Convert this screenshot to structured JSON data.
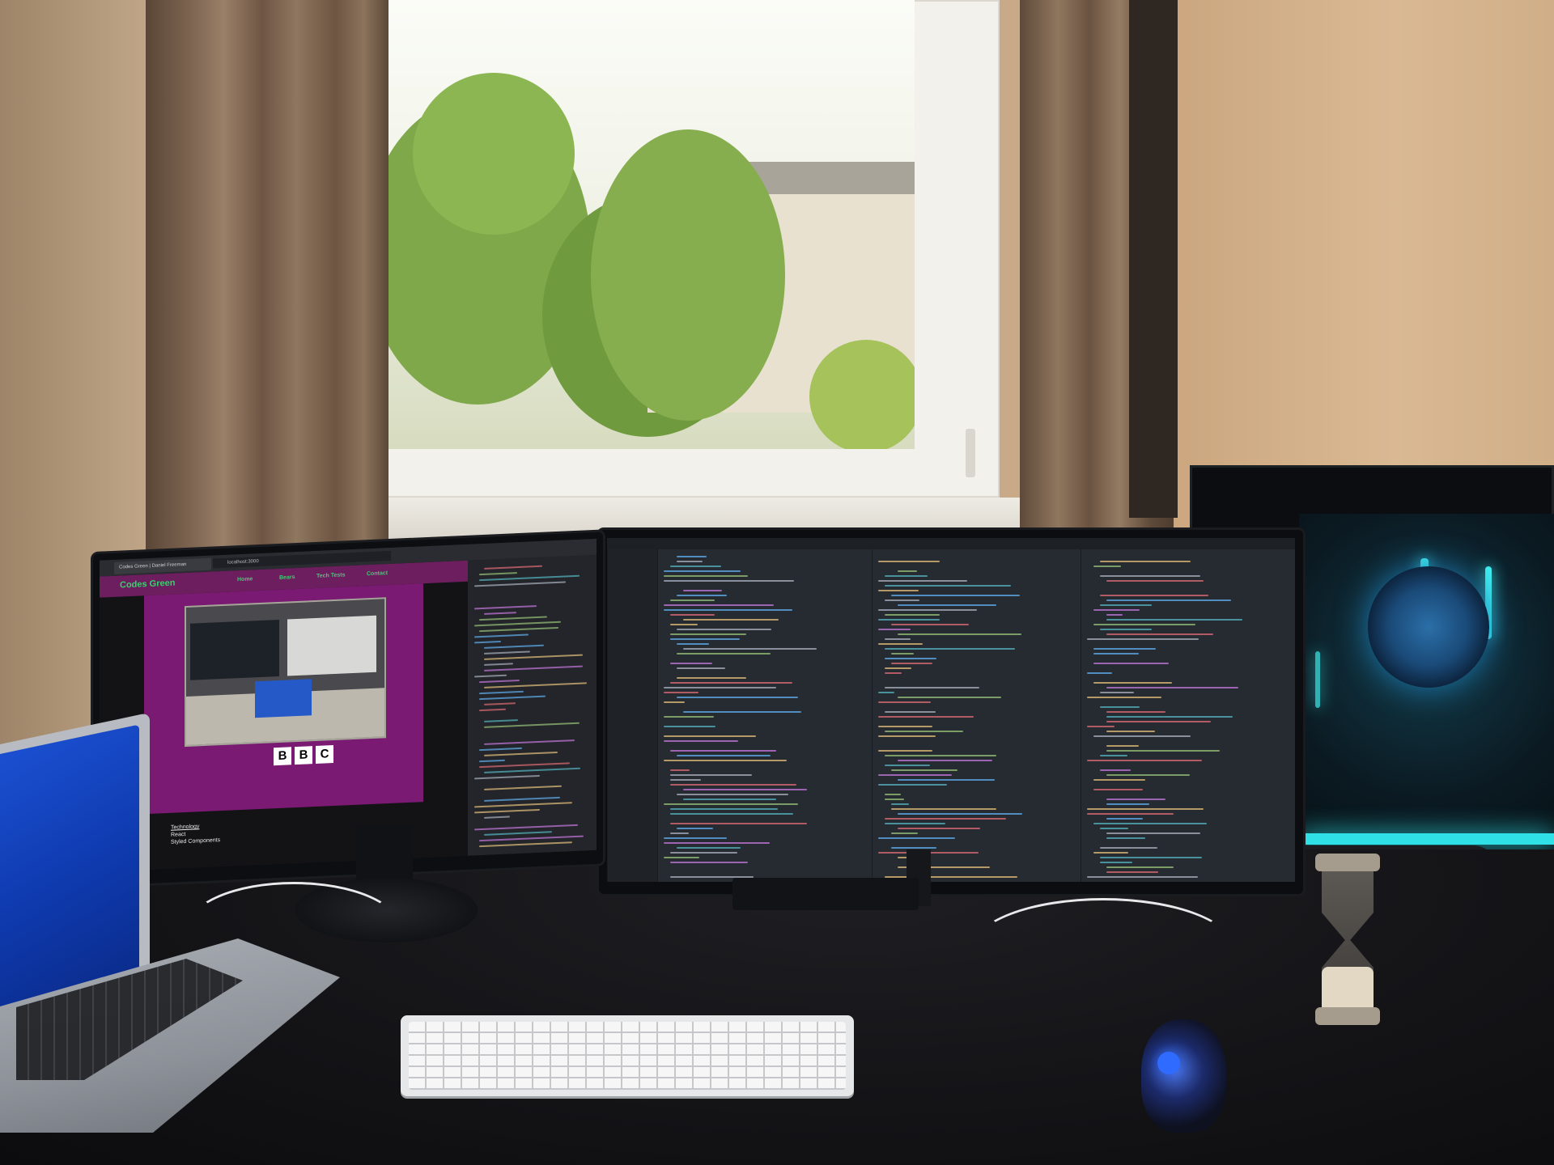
{
  "scene": {
    "description_free": true
  },
  "left_monitor": {
    "browser_tab": "Codes Green | Daniel Freeman",
    "address": "localhost:3000",
    "site": {
      "logo": "Codes Green",
      "nav": [
        "Home",
        "Bears",
        "Tech Tests",
        "Contact"
      ],
      "bbc_letters": [
        "B",
        "B",
        "C"
      ],
      "footer_heading": "Technology",
      "footer_items": [
        "React",
        "Styled Components"
      ]
    }
  },
  "colors": {
    "site_header": "#6d1e5e",
    "site_hero": "#7a1a73",
    "site_accent": "#35d36b",
    "pc_led": "#3ff0f0",
    "mouse_led": "#2f6bff",
    "laptop_screen": "#1b4fd0"
  },
  "icons": {
    "bbc_logo": "bbc-logo",
    "window_handle": "window-handle"
  }
}
